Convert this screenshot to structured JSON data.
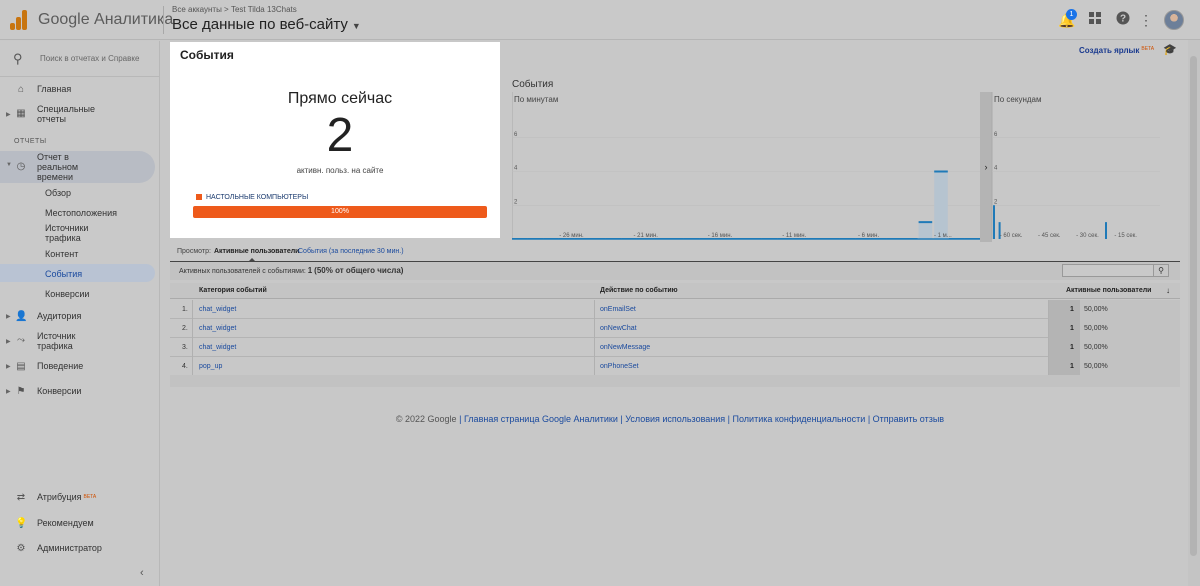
{
  "header": {
    "logo_text": "Google Аналитика",
    "breadcrumb": "Все аккаунты > Test Tilda 13Chats",
    "view_title": "Все данные по веб-сайту",
    "notifications_count": "1"
  },
  "sidebar": {
    "search_placeholder": "Поиск в отчетах и Справке",
    "items_top": [
      {
        "label": "Главная",
        "icon": "home-icon"
      },
      {
        "label": "Специальные\nотчеты",
        "icon": "dashboard-icon"
      }
    ],
    "section_reports": "ОТЧЕТЫ",
    "realtime": {
      "label": "Отчет в\nреальном\nвремени",
      "icon": "clock-icon"
    },
    "realtime_sub": [
      "Обзор",
      "Местоположения",
      "Источники\nтрафика",
      "Контент",
      "События",
      "Конверсии"
    ],
    "items_reports": [
      {
        "label": "Аудитория",
        "icon": "person-icon"
      },
      {
        "label": "Источник\nтрафика",
        "icon": "acquisition-icon"
      },
      {
        "label": "Поведение",
        "icon": "behavior-icon"
      },
      {
        "label": "Конверсии",
        "icon": "flag-icon"
      }
    ],
    "items_bottom": [
      {
        "label": "Атрибуция",
        "icon": "attribution-icon",
        "badge": "BETA"
      },
      {
        "label": "Рекомендуем",
        "icon": "lightbulb-icon"
      },
      {
        "label": "Администратор",
        "icon": "gear-icon"
      }
    ]
  },
  "card": {
    "title": "События",
    "now_label": "Прямо сейчас",
    "active_users": "2",
    "sub_label": "активн. польз. на сайте",
    "device_legend": "НАСТОЛЬНЫЕ КОМПЬЮТЕРЫ",
    "device_percent": "100%",
    "device_share": 1.0,
    "accent_color": "#ee5a1b"
  },
  "shortcut": {
    "label": "Создать ярлык",
    "badge": "BETA"
  },
  "chart_data": {
    "type": "bar",
    "title": "События",
    "panels": [
      {
        "name": "По минутам",
        "x_ticks": [
          "- 26 мин.",
          "- 21 мин.",
          "- 16 мин.",
          "- 11 мин.",
          "- 6 мин.",
          "- 1 м..."
        ],
        "y_ticks": [
          "2",
          "4",
          "6"
        ],
        "ylim": [
          0,
          8
        ],
        "values": [
          0,
          0,
          0,
          0,
          0,
          0,
          0,
          0,
          0,
          0,
          0,
          0,
          0,
          0,
          0,
          0,
          0,
          0,
          0,
          0,
          0,
          0,
          0,
          0,
          0,
          0,
          1,
          4,
          0,
          0
        ]
      },
      {
        "name": "По секундам",
        "x_ticks": [
          "- 60 сек.",
          "- 45 сек.",
          "- 30 сек.",
          "- 15 сек."
        ],
        "y_ticks": [
          "2",
          "4",
          "6"
        ],
        "ylim": [
          0,
          8
        ],
        "values": [
          2,
          1,
          0,
          0,
          0,
          0,
          0,
          0,
          0,
          0,
          0,
          0,
          0,
          0,
          0,
          0,
          0,
          0,
          0,
          0,
          1,
          0,
          0,
          0,
          0,
          0,
          0,
          0,
          0,
          0
        ]
      }
    ],
    "bar_color": "#1f7ab8"
  },
  "table": {
    "view_label": "Просмотр:",
    "tab_active": "Активные пользователи",
    "tab_other": "События (за последние 30 мин.)",
    "summary_prefix": "Активных пользователей с событиями:",
    "summary_value": "1",
    "summary_suffix": "(50% от общего числа)",
    "columns": [
      "Категория событий",
      "Действие по событию",
      "Активные пользователи"
    ],
    "rows": [
      {
        "n": "1.",
        "category": "chat_widget",
        "action": "onEmailSet",
        "users": "1",
        "pct": "50,00%"
      },
      {
        "n": "2.",
        "category": "chat_widget",
        "action": "onNewChat",
        "users": "1",
        "pct": "50,00%"
      },
      {
        "n": "3.",
        "category": "chat_widget",
        "action": "onNewMessage",
        "users": "1",
        "pct": "50,00%"
      },
      {
        "n": "4.",
        "category": "pop_up",
        "action": "onPhoneSet",
        "users": "1",
        "pct": "50,00%"
      }
    ]
  },
  "footer": {
    "copyright": "© 2022 Google",
    "links": [
      "Главная страница Google Аналитики",
      "Условия использования",
      "Политика конфиденциальности",
      "Отправить отзыв"
    ]
  }
}
